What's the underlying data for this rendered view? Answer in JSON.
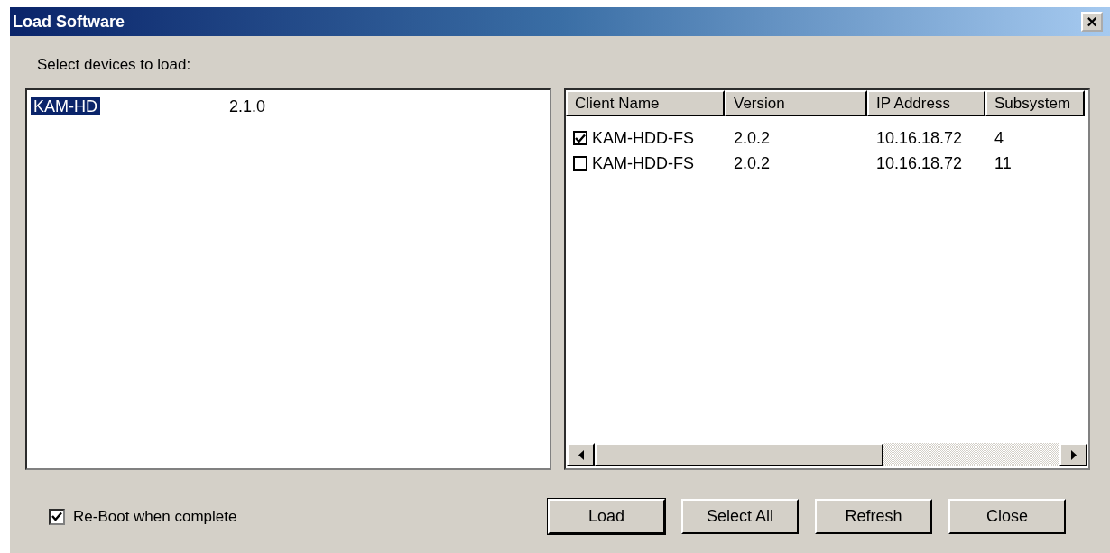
{
  "window": {
    "title": "Load Software",
    "close_glyph": "×"
  },
  "prompt": "Select devices to load:",
  "devices": [
    {
      "name": "KAM-HD",
      "version": "2.1.0",
      "selected": true
    }
  ],
  "clients": {
    "columns": [
      "Client Name",
      "Version",
      "IP Address",
      "Subsystem"
    ],
    "rows": [
      {
        "name": "KAM-HDD-FS",
        "version": "2.0.2",
        "ip": "10.16.18.72",
        "subsystem": "4",
        "checked": true
      },
      {
        "name": "KAM-HDD-FS",
        "version": "2.0.2",
        "ip": "10.16.18.72",
        "subsystem": "11",
        "checked": false
      }
    ]
  },
  "reboot": {
    "label": "Re-Boot when complete",
    "checked": true
  },
  "buttons": [
    {
      "label": "Load",
      "default": true
    },
    {
      "label": "Select All",
      "default": false
    },
    {
      "label": "Refresh",
      "default": false
    },
    {
      "label": "Close",
      "default": false
    }
  ]
}
